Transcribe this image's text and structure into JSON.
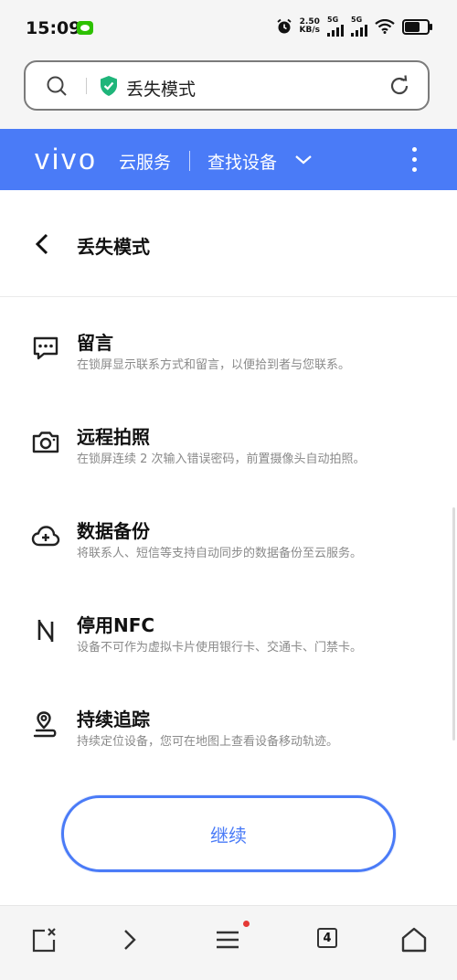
{
  "status": {
    "time": "15:09",
    "speed_value": "2.50",
    "speed_unit": "KB/s",
    "net1": "5G",
    "net2": "5G"
  },
  "urlbar": {
    "title": "丢失模式"
  },
  "header": {
    "brand": "vivo",
    "service": "云服务",
    "section": "查找设备"
  },
  "page": {
    "title": "丢失模式"
  },
  "features": [
    {
      "title": "留言",
      "desc": "在锁屏显示联系方式和留言，以便拾到者与您联系。",
      "icon": "message-icon"
    },
    {
      "title": "远程拍照",
      "desc": "在锁屏连续 2 次输入错误密码，前置摄像头自动拍照。",
      "icon": "camera-icon"
    },
    {
      "title": "数据备份",
      "desc": "将联系人、短信等支持自动同步的数据备份至云服务。",
      "icon": "cloud-backup-icon"
    },
    {
      "title": "停用NFC",
      "desc": "设备不可作为虚拟卡片使用银行卡、交通卡、门禁卡。",
      "icon": "nfc-icon"
    },
    {
      "title": "持续追踪",
      "desc": "持续定位设备，您可在地图上查看设备移动轨迹。",
      "icon": "location-track-icon"
    }
  ],
  "continue_label": "继续",
  "bottom_nav": {
    "tab_count": "4"
  },
  "colors": {
    "accent": "#4a7bf7",
    "notification_dot": "#e53935"
  }
}
